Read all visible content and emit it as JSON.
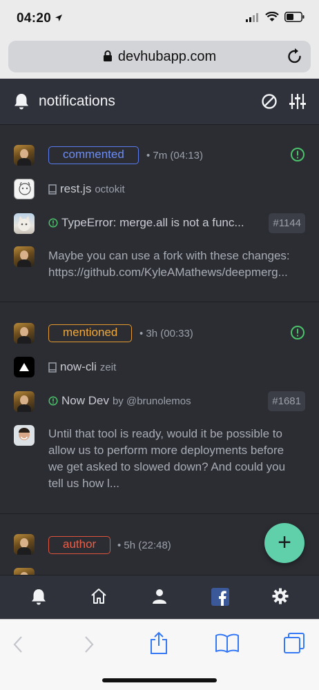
{
  "status": {
    "time": "04:20"
  },
  "browser": {
    "url": "devhubapp.com"
  },
  "header": {
    "title": "notifications"
  },
  "notifications": [
    {
      "reason": "commented",
      "time": "• 7m (04:13)",
      "repo": "rest.js",
      "owner": "octokit",
      "subject": "TypeError: merge.all is not a func...",
      "number": "#1144",
      "body": [
        "Maybe you can use a fork with these changes:",
        "https://github.com/KyleAMathews/deepmerg..."
      ]
    },
    {
      "reason": "mentioned",
      "time": "• 3h (00:33)",
      "repo": "now-cli",
      "owner": "zeit",
      "subject": "Now Dev",
      "subject_by": "by @brunolemos",
      "number": "#1681",
      "body": [
        "Until that tool is ready, would it be possible to",
        "allow us to perform more deployments before",
        "we get asked to slowed down? And could you",
        "tell us how l..."
      ]
    },
    {
      "reason": "author",
      "time": "• 5h (22:48)"
    }
  ],
  "colors": {
    "commented": "#5a7cf0",
    "mentioned": "#e59b2f",
    "author": "#e0533d",
    "open_state": "#4cc46b",
    "fab": "#5fd0aa",
    "facebook": "#3b5998"
  },
  "icons": {
    "header": [
      "bell-icon",
      "ban-icon",
      "sliders-icon"
    ],
    "tabs": [
      "bell-icon",
      "home-icon",
      "user-icon",
      "facebook-icon",
      "gear-icon"
    ],
    "safari": [
      "back-icon",
      "forward-icon",
      "share-icon",
      "bookmarks-icon",
      "tabs-icon"
    ]
  }
}
